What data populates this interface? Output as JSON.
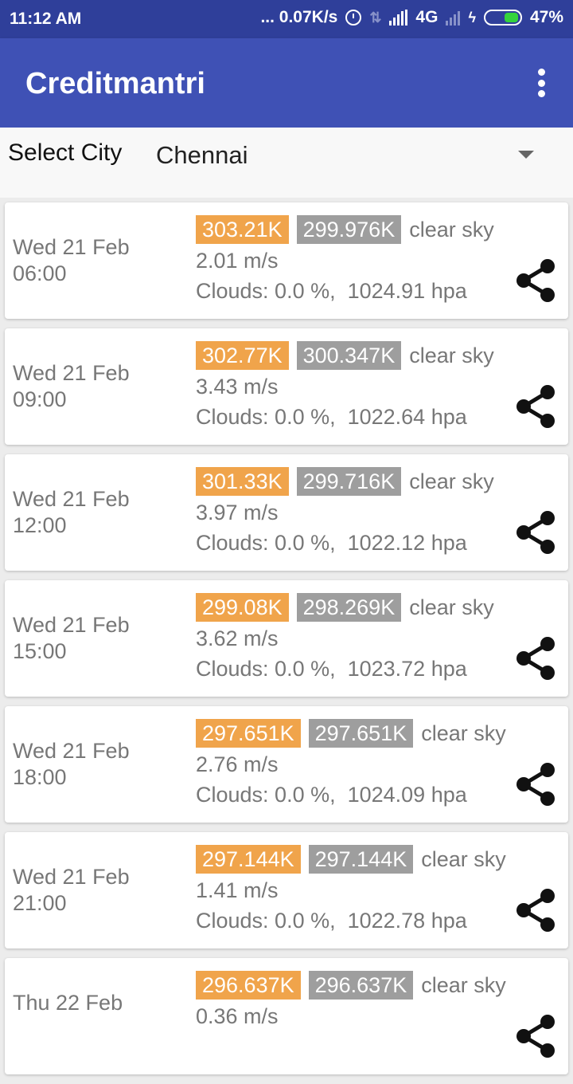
{
  "status_bar": {
    "time": "11:12 AM",
    "net_speed": "... 0.07K/s",
    "network_type": "4G",
    "battery": "47%"
  },
  "app": {
    "title": "Creditmantri"
  },
  "city": {
    "label": "Select City",
    "selected": "Chennai"
  },
  "forecasts": [
    {
      "date": "Wed 21 Feb",
      "time": "06:00",
      "temp_max": "303.21K",
      "temp_min": "299.976K",
      "description": "clear sky",
      "wind": "2.01 m/s",
      "clouds": "Clouds: 0.0 %,  1024.91 hpa"
    },
    {
      "date": "Wed 21 Feb",
      "time": "09:00",
      "temp_max": "302.77K",
      "temp_min": "300.347K",
      "description": "clear sky",
      "wind": "3.43 m/s",
      "clouds": "Clouds: 0.0 %,  1022.64 hpa"
    },
    {
      "date": "Wed 21 Feb",
      "time": "12:00",
      "temp_max": "301.33K",
      "temp_min": "299.716K",
      "description": "clear sky",
      "wind": "3.97 m/s",
      "clouds": "Clouds: 0.0 %,  1022.12 hpa"
    },
    {
      "date": "Wed 21 Feb",
      "time": "15:00",
      "temp_max": "299.08K",
      "temp_min": "298.269K",
      "description": "clear sky",
      "wind": "3.62 m/s",
      "clouds": "Clouds: 0.0 %,  1023.72 hpa"
    },
    {
      "date": "Wed 21 Feb",
      "time": "18:00",
      "temp_max": "297.651K",
      "temp_min": "297.651K",
      "description": "clear sky",
      "wind": "2.76 m/s",
      "clouds": "Clouds: 0.0 %,  1024.09 hpa"
    },
    {
      "date": "Wed 21 Feb",
      "time": "21:00",
      "temp_max": "297.144K",
      "temp_min": "297.144K",
      "description": "clear sky",
      "wind": "1.41 m/s",
      "clouds": "Clouds: 0.0 %,  1022.78 hpa"
    },
    {
      "date": "Thu 22 Feb",
      "time": "",
      "temp_max": "296.637K",
      "temp_min": "296.637K",
      "description": "clear sky",
      "wind": "0.36 m/s",
      "clouds": ""
    }
  ],
  "icons": {
    "overflow": "more-vert-icon",
    "share": "share-icon",
    "dropdown": "dropdown-arrow-icon"
  },
  "colors": {
    "app_bar": "#3f51b5",
    "status_bar": "#2f3f9a",
    "temp_max_badge": "#f0a44b",
    "temp_min_badge": "#9e9e9e"
  }
}
